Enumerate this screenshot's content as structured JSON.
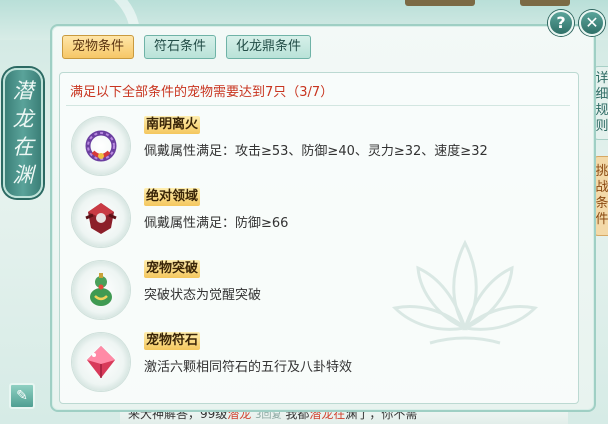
{
  "banner": {
    "chars": [
      "潜",
      "龙",
      "在",
      "渊"
    ]
  },
  "dialog": {
    "help_label": "?",
    "close_label": "✕",
    "tabs": [
      {
        "label": "宠物条件",
        "active": true
      },
      {
        "label": "符石条件",
        "active": false
      },
      {
        "label": "化龙鼎条件",
        "active": false
      }
    ],
    "header": "满足以下全部条件的宠物需要达到7只（3/7）",
    "conditions": [
      {
        "name": "南明离火",
        "desc": "佩戴属性满足：攻击≥53、防御≥40、灵力≥32、速度≥32",
        "icon": "ring-icon"
      },
      {
        "name": "绝对领域",
        "desc": "佩戴属性满足：防御≥66",
        "icon": "red-jewel-icon"
      },
      {
        "name": "宠物突破",
        "desc": "突破状态为觉醒突破",
        "icon": "gourd-icon"
      },
      {
        "name": "宠物符石",
        "desc": "激活六颗相同符石的五行及八卦特效",
        "icon": "gem-icon"
      }
    ]
  },
  "side_tabs": [
    {
      "label": [
        "详",
        "细",
        "规",
        "则"
      ]
    },
    {
      "label": [
        "挑",
        "战",
        "条",
        "件"
      ]
    }
  ],
  "chat_strip": {
    "part1": "来大神解答，99级",
    "highlight1": "潜龙",
    "level": "3回复",
    "part2": "我都",
    "highlight2": "潜龙在",
    "part3": "渊了，你不需"
  },
  "colors": {
    "header_text": "#c8341f",
    "active_tab": "#f6c767",
    "name_badge": "#f4c75e"
  }
}
